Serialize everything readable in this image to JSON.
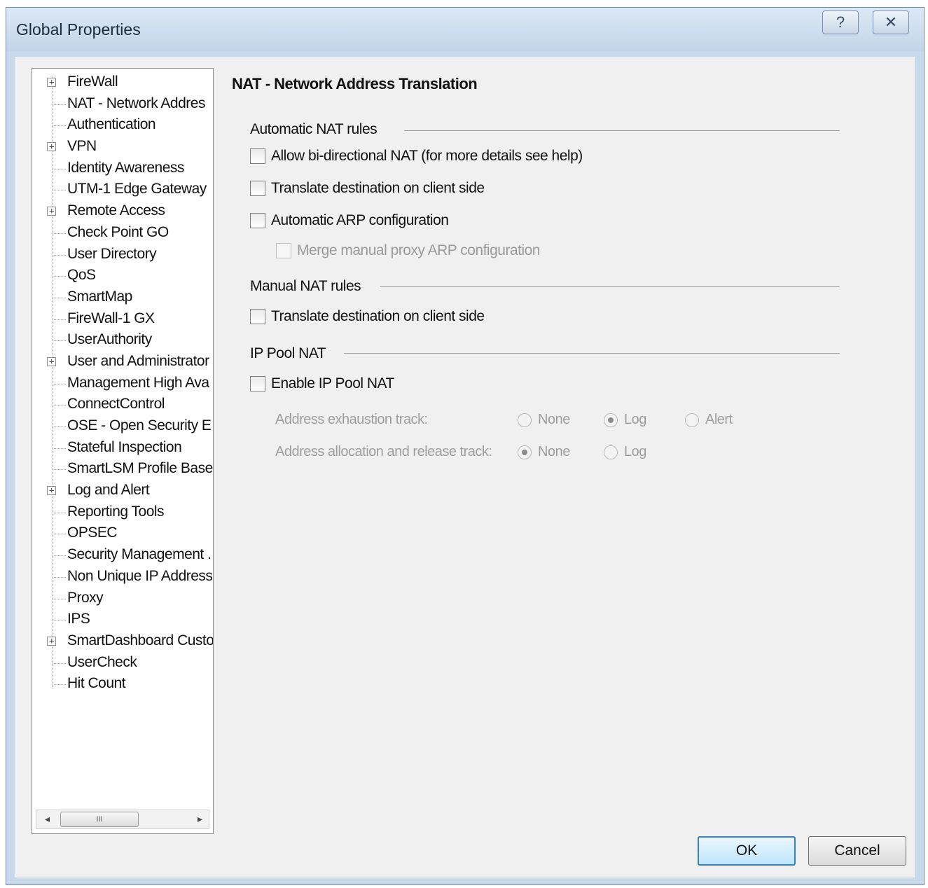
{
  "window": {
    "title": "Global Properties",
    "help_button": "?",
    "close_button": "✕"
  },
  "tree": {
    "items": [
      {
        "label": "FireWall",
        "expandable": true
      },
      {
        "label": "NAT - Network Addres",
        "expandable": false
      },
      {
        "label": "Authentication",
        "expandable": false
      },
      {
        "label": "VPN",
        "expandable": true
      },
      {
        "label": "Identity Awareness",
        "expandable": false
      },
      {
        "label": "UTM-1 Edge Gateway",
        "expandable": false
      },
      {
        "label": "Remote Access",
        "expandable": true
      },
      {
        "label": "Check Point GO",
        "expandable": false
      },
      {
        "label": "User Directory",
        "expandable": false
      },
      {
        "label": "QoS",
        "expandable": false
      },
      {
        "label": "SmartMap",
        "expandable": false
      },
      {
        "label": "FireWall-1 GX",
        "expandable": false
      },
      {
        "label": "UserAuthority",
        "expandable": false
      },
      {
        "label": "User and Administrator",
        "expandable": true
      },
      {
        "label": "Management High Ava",
        "expandable": false
      },
      {
        "label": "ConnectControl",
        "expandable": false
      },
      {
        "label": "OSE - Open Security E",
        "expandable": false
      },
      {
        "label": "Stateful Inspection",
        "expandable": false
      },
      {
        "label": "SmartLSM Profile Base",
        "expandable": false
      },
      {
        "label": "Log and Alert",
        "expandable": true
      },
      {
        "label": "Reporting Tools",
        "expandable": false
      },
      {
        "label": "OPSEC",
        "expandable": false
      },
      {
        "label": "Security Management .",
        "expandable": false
      },
      {
        "label": "Non Unique IP Address",
        "expandable": false
      },
      {
        "label": "Proxy",
        "expandable": false
      },
      {
        "label": "IPS",
        "expandable": false
      },
      {
        "label": "SmartDashboard Custo",
        "expandable": true
      },
      {
        "label": "UserCheck",
        "expandable": false
      },
      {
        "label": "Hit Count",
        "expandable": false
      }
    ],
    "scrollbar": {
      "left_arrow": "◂",
      "right_arrow": "▸",
      "thumb_grip": "III"
    }
  },
  "page": {
    "title": "NAT - Network Address Translation",
    "automatic": {
      "header": "Automatic NAT rules",
      "bidirectional": {
        "label": "Allow bi-directional NAT  (for more details see help)",
        "checked": false
      },
      "translate_dest": {
        "label": "Translate destination on client side",
        "checked": false
      },
      "arp": {
        "label": "Automatic ARP configuration",
        "checked": false
      },
      "merge_arp": {
        "label": "Merge manual proxy ARP configuration",
        "checked": false,
        "enabled": false
      }
    },
    "manual": {
      "header": "Manual NAT rules",
      "translate_dest": {
        "label": "Translate destination on client side",
        "checked": false
      }
    },
    "ip_pool": {
      "header": "IP Pool NAT",
      "enable": {
        "label": "Enable IP Pool NAT",
        "checked": false
      },
      "exhaustion": {
        "label": "Address exhaustion track:",
        "options": [
          "None",
          "Log",
          "Alert"
        ],
        "selected": "Log"
      },
      "allocation": {
        "label": "Address allocation and release track:",
        "options": [
          "None",
          "Log"
        ],
        "selected": "None"
      }
    }
  },
  "buttons": {
    "ok": "OK",
    "cancel": "Cancel"
  }
}
